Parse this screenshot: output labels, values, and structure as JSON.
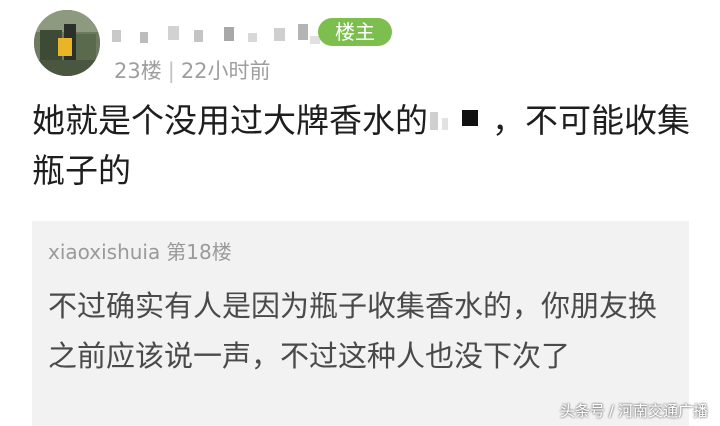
{
  "comment": {
    "author_badge": "楼主",
    "floor": "23楼",
    "time": "22小时前",
    "text_before_censor": "她就是个没用过大牌香水的",
    "text_after_censor": "，不可能收集瓶子的"
  },
  "quote": {
    "author": "xiaoxishuia",
    "floor": "第18楼",
    "text": "不过确实有人是因为瓶子收集香水的，你朋友换之前应该说一声，不过这种人也没下次了"
  },
  "watermark": {
    "platform": "头条号",
    "source": "河南交通广播"
  },
  "colors": {
    "badge": "#7dbf4f",
    "meta_text": "#9e9e9e",
    "quote_background": "#f2f2f2"
  }
}
